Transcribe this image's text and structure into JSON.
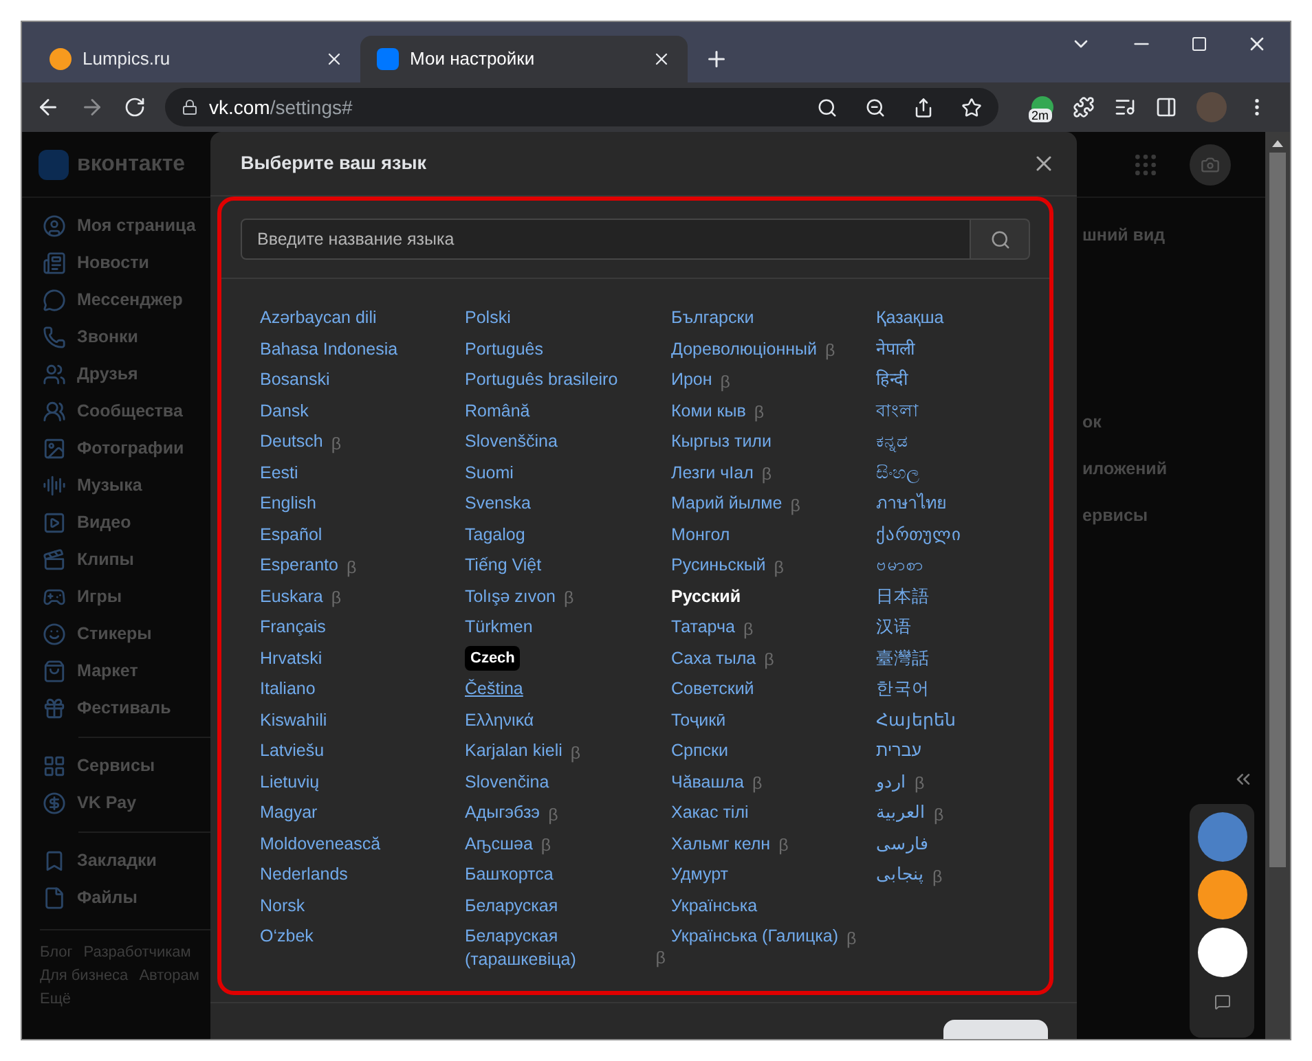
{
  "browser": {
    "tabs": [
      {
        "title": "Lumpics.ru",
        "selected": false
      },
      {
        "title": "Мои настройки",
        "selected": true
      }
    ],
    "address": {
      "host": "vk.com",
      "path": "/settings#"
    },
    "extension_badge": "2m"
  },
  "site": {
    "logo": "вконтакте",
    "nav_groups": [
      [
        "Моя страница",
        "Новости",
        "Мессенджер",
        "Звонки",
        "Друзья",
        "Сообщества",
        "Фотографии",
        "Музыка",
        "Видео",
        "Клипы",
        "Игры",
        "Стикеры",
        "Маркет",
        "Фестиваль"
      ],
      [
        "Сервисы",
        "VK Pay"
      ],
      [
        "Закладки",
        "Файлы"
      ]
    ],
    "footer_links": [
      "Блог",
      "Разработчикам",
      "Для бизнеса",
      "Авторам",
      "Ещё"
    ],
    "settings_fragments": [
      "шний вид",
      "ок",
      "иложений",
      "ервисы"
    ]
  },
  "dialog": {
    "title": "Выберите ваш язык",
    "search": {
      "placeholder": "Введите название языка"
    },
    "columns": [
      [
        {
          "kind": "language",
          "label": "Azərbaycan dili",
          "selected": false,
          "hovered": false
        },
        {
          "kind": "language",
          "label": "Bahasa Indonesia",
          "selected": false,
          "hovered": false
        },
        {
          "kind": "language",
          "label": "Bosanski",
          "selected": false,
          "hovered": false
        },
        {
          "kind": "language",
          "label": "Dansk",
          "selected": false,
          "hovered": false
        },
        {
          "kind": "language",
          "label": "Deutsch",
          "badge": "β",
          "selected": false,
          "hovered": false
        },
        {
          "kind": "language",
          "label": "Eesti",
          "selected": false,
          "hovered": false
        },
        {
          "kind": "language",
          "label": "English",
          "selected": false,
          "hovered": false
        },
        {
          "kind": "language",
          "label": "Español",
          "selected": false,
          "hovered": false
        },
        {
          "kind": "language",
          "label": "Esperanto",
          "badge": "β",
          "selected": false,
          "hovered": false
        },
        {
          "kind": "language",
          "label": "Euskara",
          "badge": "β",
          "selected": false,
          "hovered": false
        },
        {
          "kind": "language",
          "label": "Français",
          "selected": false,
          "hovered": false
        },
        {
          "kind": "language",
          "label": "Hrvatski",
          "selected": false,
          "hovered": false
        },
        {
          "kind": "language",
          "label": "Italiano",
          "selected": false,
          "hovered": false
        },
        {
          "kind": "language",
          "label": "Kiswahili",
          "selected": false,
          "hovered": false
        },
        {
          "kind": "language",
          "label": "Latviešu",
          "selected": false,
          "hovered": false
        },
        {
          "kind": "language",
          "label": "Lietuvių",
          "selected": false,
          "hovered": false
        },
        {
          "kind": "language",
          "label": "Magyar",
          "selected": false,
          "hovered": false
        },
        {
          "kind": "language",
          "label": "Moldovenească",
          "selected": false,
          "hovered": false
        },
        {
          "kind": "language",
          "label": "Nederlands",
          "selected": false,
          "hovered": false
        },
        {
          "kind": "language",
          "label": "Norsk",
          "selected": false,
          "hovered": false
        },
        {
          "kind": "language",
          "label": "O‘zbek",
          "selected": false,
          "hovered": false
        }
      ],
      [
        {
          "kind": "language",
          "label": "Polski",
          "selected": false,
          "hovered": false
        },
        {
          "kind": "language",
          "label": "Português",
          "selected": false,
          "hovered": false
        },
        {
          "kind": "language",
          "label": "Português brasileiro",
          "selected": false,
          "hovered": false
        },
        {
          "kind": "language",
          "label": "Română",
          "selected": false,
          "hovered": false
        },
        {
          "kind": "language",
          "label": "Slovenščina",
          "selected": false,
          "hovered": false
        },
        {
          "kind": "language",
          "label": "Suomi",
          "selected": false,
          "hovered": false
        },
        {
          "kind": "language",
          "label": "Svenska",
          "selected": false,
          "hovered": false
        },
        {
          "kind": "language",
          "label": "Tagalog",
          "selected": false,
          "hovered": false
        },
        {
          "kind": "language",
          "label": "Tiếng Việt",
          "selected": false,
          "hovered": false
        },
        {
          "kind": "language",
          "label": "Tolışə zıvon",
          "badge": "β",
          "selected": false,
          "hovered": false
        },
        {
          "kind": "language",
          "label": "Türkmen",
          "selected": false,
          "hovered": false
        },
        {
          "kind": "tooltip",
          "label": "Czech"
        },
        {
          "kind": "language",
          "label": "Čeština",
          "selected": false,
          "hovered": true
        },
        {
          "kind": "language",
          "label": "Ελληνικά",
          "selected": false,
          "hovered": false
        },
        {
          "kind": "language",
          "label": "Karjalan kieli",
          "badge": "β",
          "selected": false,
          "hovered": false
        },
        {
          "kind": "language",
          "label": "Slovenčina",
          "selected": false,
          "hovered": false
        },
        {
          "kind": "language",
          "label": "Адыгэбзэ",
          "badge": "β",
          "selected": false,
          "hovered": false
        },
        {
          "kind": "language",
          "label": "Аҧсшәа",
          "badge": "β",
          "selected": false,
          "hovered": false
        },
        {
          "kind": "language",
          "label": "Башҡортса",
          "selected": false,
          "hovered": false
        },
        {
          "kind": "language",
          "label": "Беларуская",
          "selected": false,
          "hovered": false
        },
        {
          "kind": "language",
          "label": "Беларуская (тарашкевіца)",
          "badge": "β",
          "selected": false,
          "hovered": false
        }
      ],
      [
        {
          "kind": "language",
          "label": "Български",
          "selected": false,
          "hovered": false
        },
        {
          "kind": "language",
          "label": "Дореволюціонный",
          "badge": "β",
          "selected": false,
          "hovered": false
        },
        {
          "kind": "language",
          "label": "Ирон",
          "badge": "β",
          "selected": false,
          "hovered": false
        },
        {
          "kind": "language",
          "label": "Коми кыв",
          "badge": "β",
          "selected": false,
          "hovered": false
        },
        {
          "kind": "language",
          "label": "Кыргыз тили",
          "selected": false,
          "hovered": false
        },
        {
          "kind": "language",
          "label": "Лезги чIал",
          "badge": "β",
          "selected": false,
          "hovered": false
        },
        {
          "kind": "language",
          "label": "Марий йылме",
          "badge": "β",
          "selected": false,
          "hovered": false
        },
        {
          "kind": "language",
          "label": "Монгол",
          "selected": false,
          "hovered": false
        },
        {
          "kind": "language",
          "label": "Русиньскый",
          "badge": "β",
          "selected": false,
          "hovered": false
        },
        {
          "kind": "language",
          "label": "Русский",
          "selected": true,
          "hovered": false
        },
        {
          "kind": "language",
          "label": "Татарча",
          "badge": "β",
          "selected": false,
          "hovered": false
        },
        {
          "kind": "language",
          "label": "Саха тыла",
          "badge": "β",
          "selected": false,
          "hovered": false
        },
        {
          "kind": "language",
          "label": "Советский",
          "selected": false,
          "hovered": false
        },
        {
          "kind": "language",
          "label": "Тоҷикӣ",
          "selected": false,
          "hovered": false
        },
        {
          "kind": "language",
          "label": "Српски",
          "selected": false,
          "hovered": false
        },
        {
          "kind": "language",
          "label": "Чӑвашла",
          "badge": "β",
          "selected": false,
          "hovered": false
        },
        {
          "kind": "language",
          "label": "Хакас тілі",
          "selected": false,
          "hovered": false
        },
        {
          "kind": "language",
          "label": "Хальмг келн",
          "badge": "β",
          "selected": false,
          "hovered": false
        },
        {
          "kind": "language",
          "label": "Удмурт",
          "selected": false,
          "hovered": false
        },
        {
          "kind": "language",
          "label": "Українська",
          "selected": false,
          "hovered": false
        },
        {
          "kind": "language",
          "label": "Українська (Галицка)",
          "badge": "β",
          "selected": false,
          "hovered": false
        }
      ],
      [
        {
          "kind": "language",
          "label": "Қазақша",
          "selected": false,
          "hovered": false
        },
        {
          "kind": "language",
          "label": "नेपाली",
          "selected": false,
          "hovered": false
        },
        {
          "kind": "language",
          "label": "हिन्दी",
          "selected": false,
          "hovered": false
        },
        {
          "kind": "language",
          "label": "বাংলা",
          "selected": false,
          "hovered": false
        },
        {
          "kind": "language",
          "label": "ಕನ್ನಡ",
          "selected": false,
          "hovered": false
        },
        {
          "kind": "language",
          "label": "සිංහල",
          "selected": false,
          "hovered": false
        },
        {
          "kind": "language",
          "label": "ภาษาไทย",
          "selected": false,
          "hovered": false
        },
        {
          "kind": "language",
          "label": "ქართული",
          "selected": false,
          "hovered": false
        },
        {
          "kind": "language",
          "label": "ဗမာစာ",
          "selected": false,
          "hovered": false
        },
        {
          "kind": "language",
          "label": "日本語",
          "selected": false,
          "hovered": false
        },
        {
          "kind": "language",
          "label": "汉语",
          "selected": false,
          "hovered": false
        },
        {
          "kind": "language",
          "label": "臺灣話",
          "selected": false,
          "hovered": false
        },
        {
          "kind": "language",
          "label": "한국어",
          "selected": false,
          "hovered": false
        },
        {
          "kind": "language",
          "label": "Հայերեն",
          "selected": false,
          "hovered": false
        },
        {
          "kind": "language",
          "label": "עברית",
          "selected": false,
          "hovered": false
        },
        {
          "kind": "language",
          "label": "اردو",
          "badge": "β",
          "selected": false,
          "hovered": false
        },
        {
          "kind": "language",
          "label": "العربية",
          "badge": "β",
          "selected": false,
          "hovered": false
        },
        {
          "kind": "language",
          "label": "فارسی",
          "selected": false,
          "hovered": false
        },
        {
          "kind": "language",
          "label": "پنجابی",
          "badge": "β",
          "selected": false,
          "hovered": false
        }
      ]
    ]
  }
}
